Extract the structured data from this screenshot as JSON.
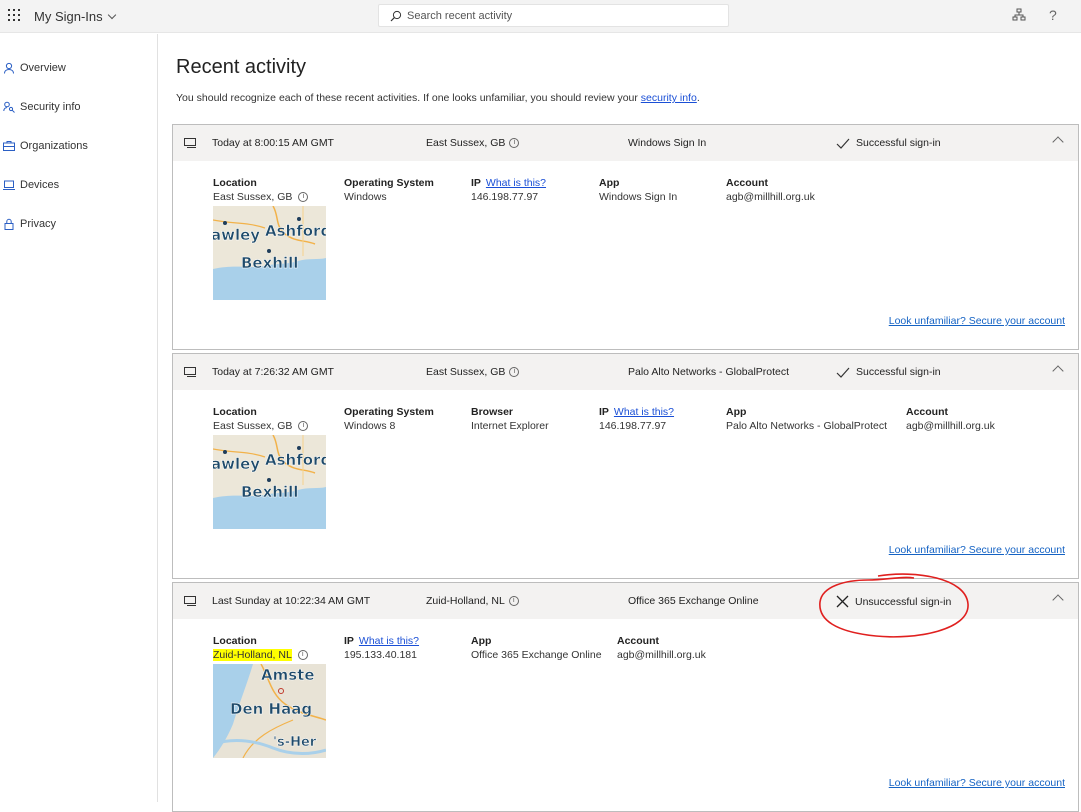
{
  "header": {
    "app_title": "My Sign-Ins",
    "search_placeholder": "Search recent activity",
    "help_label": "?"
  },
  "sidebar": {
    "items": [
      {
        "label": "Overview",
        "icon": "person-icon"
      },
      {
        "label": "Security info",
        "icon": "key-person-icon"
      },
      {
        "label": "Organizations",
        "icon": "briefcase-icon"
      },
      {
        "label": "Devices",
        "icon": "laptop-icon"
      },
      {
        "label": "Privacy",
        "icon": "lock-icon"
      }
    ]
  },
  "main": {
    "title": "Recent activity",
    "intro_text": "You should recognize each of these recent activities. If one looks unfamiliar, you should review your ",
    "intro_link": "security info",
    "intro_end": ".",
    "secure_link": "Look unfamiliar? Secure your account",
    "labels": {
      "location": "Location",
      "os": "Operating System",
      "browser": "Browser",
      "ip": "IP",
      "what_is_this": "What is this?",
      "app": "App",
      "account": "Account"
    },
    "activities": [
      {
        "time": "Today at 8:00:15 AM GMT",
        "location": "East Sussex, GB",
        "app": "Windows Sign In",
        "status": "Successful sign-in",
        "os": "Windows",
        "ip": "146.198.77.97",
        "account": "agb@millhill.org.uk",
        "map_labels": [
          "awley",
          "Ashford",
          "Bexhill"
        ]
      },
      {
        "time": "Today at 7:26:32 AM GMT",
        "location": "East Sussex, GB",
        "app": "Palo Alto Networks - GlobalProtect",
        "status": "Successful sign-in",
        "os": "Windows 8",
        "browser": "Internet Explorer",
        "ip": "146.198.77.97",
        "account": "agb@millhill.org.uk",
        "map_labels": [
          "awley",
          "Ashford",
          "Bexhill"
        ]
      },
      {
        "time": "Last Sunday at 10:22:34 AM GMT",
        "location": "Zuid-Holland, NL",
        "app": "Office 365 Exchange Online",
        "status": "Unsuccessful sign-in",
        "ip": "195.133.40.181",
        "account": "agb@millhill.org.uk",
        "map_labels": [
          "Amste",
          "Den Haag",
          "'s-Her"
        ]
      }
    ]
  },
  "colors": {
    "link": "#1a4fd6",
    "annotation_circle": "#e0201f",
    "highlight": "#ffff00"
  }
}
